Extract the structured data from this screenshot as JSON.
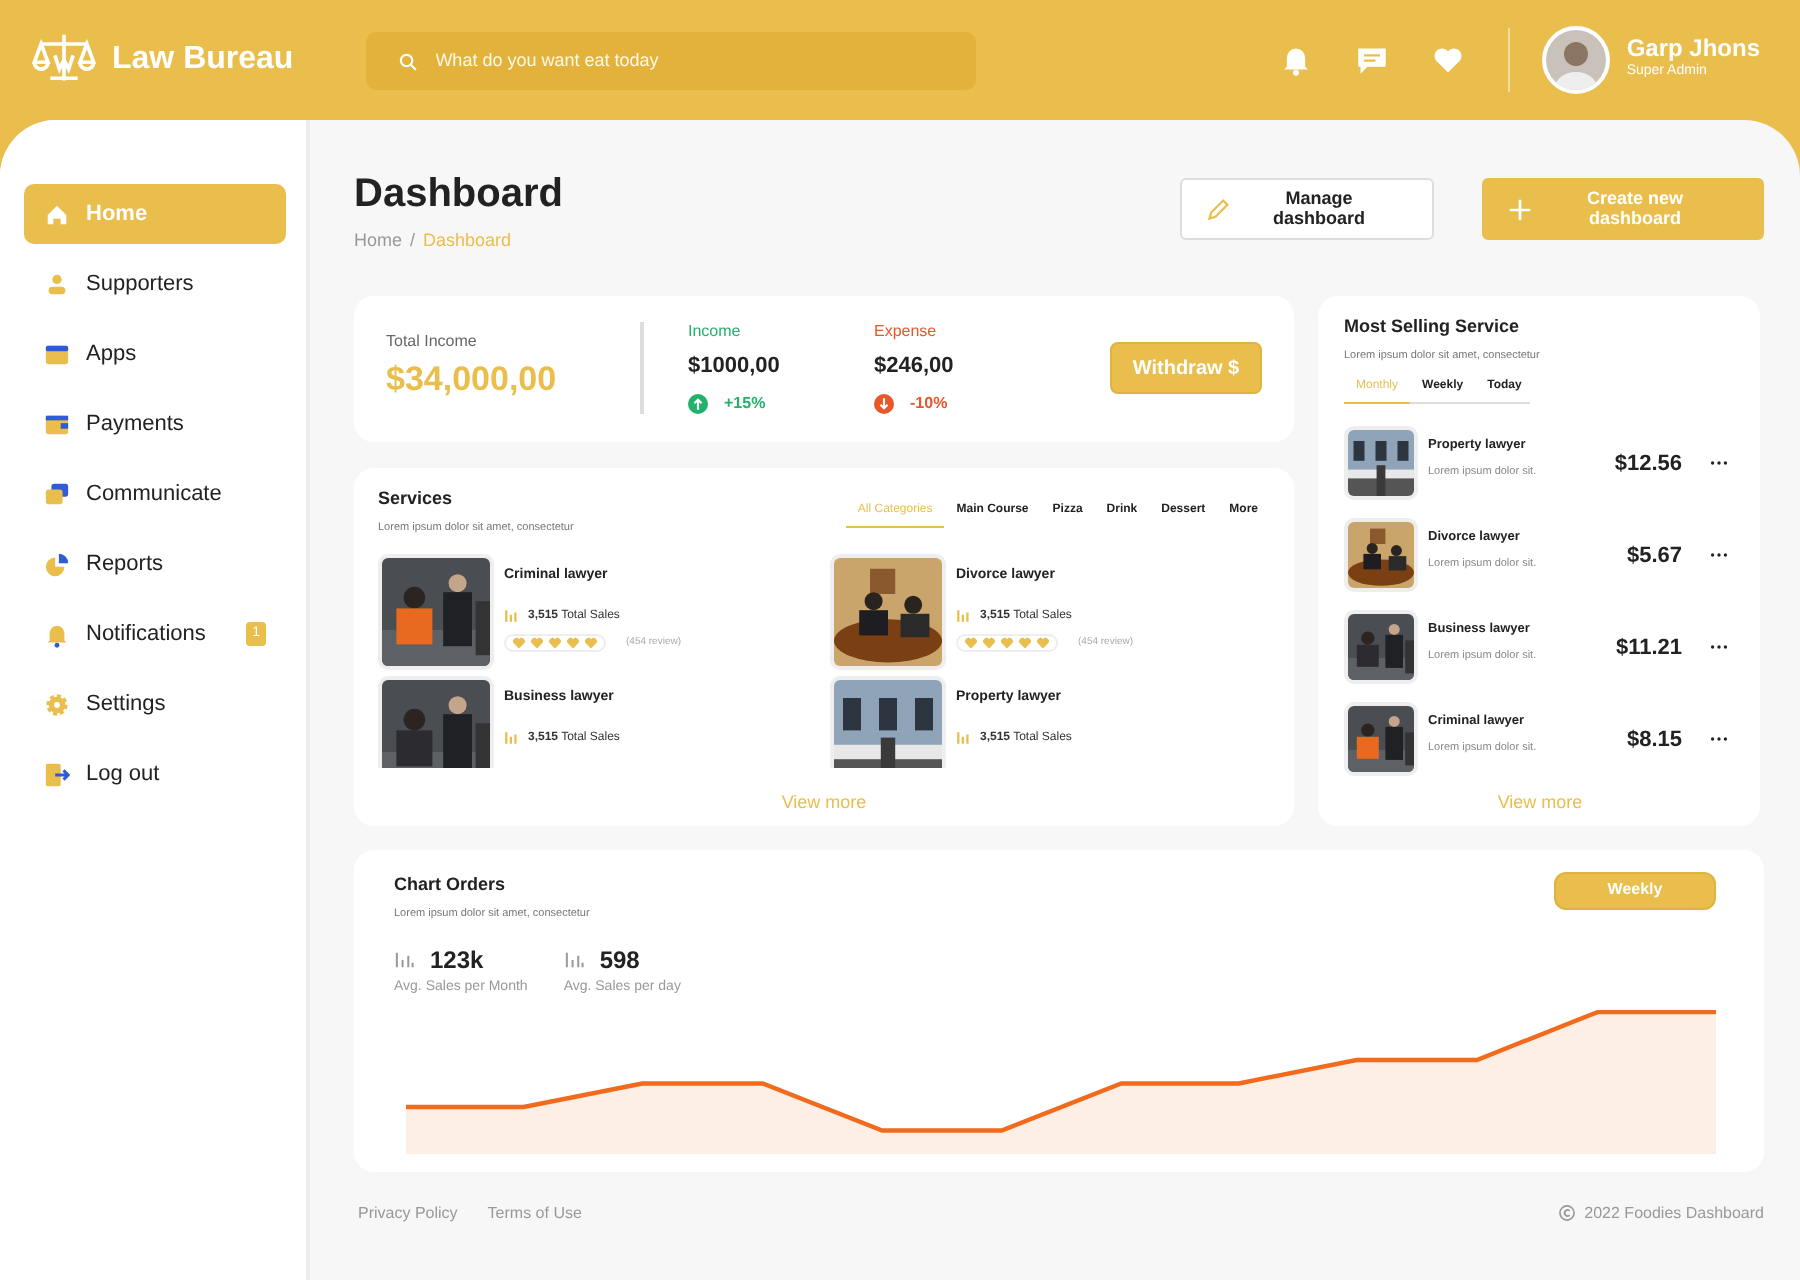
{
  "app": {
    "name": "Law Bureau"
  },
  "search": {
    "placeholder": "What do you want eat today"
  },
  "user": {
    "name": "Garp Jhons",
    "role": "Super Admin"
  },
  "sidebar": {
    "items": [
      {
        "label": "Home",
        "selected": true
      },
      {
        "label": "Supporters",
        "selected": false
      },
      {
        "label": "Apps",
        "selected": false
      },
      {
        "label": "Payments",
        "selected": false
      },
      {
        "label": "Communicate",
        "selected": false
      },
      {
        "label": "Reports",
        "selected": false
      },
      {
        "label": "Notifications",
        "selected": false,
        "badge": "1"
      },
      {
        "label": "Settings",
        "selected": false
      },
      {
        "label": "Log out",
        "selected": false
      }
    ]
  },
  "page": {
    "title": "Dashboard",
    "breadcrumb": [
      {
        "label": "Home",
        "selected": false
      },
      {
        "label": "Dashboard",
        "selected": true
      }
    ],
    "separator": "/"
  },
  "actions": [
    {
      "label": "Manage dashboard",
      "kind": "outline"
    },
    {
      "label": "Create new dashboard",
      "kind": "primary"
    }
  ],
  "income": {
    "label": "Total Income",
    "value": "$34,000,00",
    "stats": [
      {
        "label": "Income",
        "value": "$1000,00",
        "change": "+15%",
        "rising": true
      },
      {
        "label": "Expense",
        "value": "$246,00",
        "change": "-10%",
        "rising": false
      }
    ],
    "button": {
      "label": "Withdraw",
      "symbol": "$"
    }
  },
  "services": {
    "title": "Services",
    "subtitle": "Lorem ipsum dolor sit amet, consectetur",
    "tabs": [
      {
        "label": "All Categories",
        "selected": true
      },
      {
        "label": "Main Course",
        "selected": false
      },
      {
        "label": "Pizza",
        "selected": false
      },
      {
        "label": "Drink",
        "selected": false
      },
      {
        "label": "Dessert",
        "selected": false
      },
      {
        "label": "More",
        "selected": false
      }
    ],
    "items": [
      {
        "name": "Criminal lawyer",
        "sales_count": "3,515",
        "sales_label": "Total Sales",
        "stars": 5,
        "reviews": "(454 review)"
      },
      {
        "name": "Divorce lawyer",
        "sales_count": "3,515",
        "sales_label": "Total Sales",
        "stars": 5,
        "reviews": "(454 review)"
      },
      {
        "name": "Business lawyer",
        "sales_count": "3,515",
        "sales_label": "Total Sales"
      },
      {
        "name": "Property lawyer",
        "sales_count": "3,515",
        "sales_label": "Total Sales"
      }
    ],
    "link": "View more"
  },
  "most_selling": {
    "title": "Most Selling Service",
    "subtitle": "Lorem ipsum dolor sit amet, consectetur",
    "tabs": [
      {
        "label": "Monthly",
        "selected": true
      },
      {
        "label": "Weekly",
        "selected": false
      },
      {
        "label": "Today",
        "selected": false
      }
    ],
    "items": [
      {
        "name": "Property lawyer",
        "description": "Lorem ipsum dolor sit.",
        "price": "$12.56"
      },
      {
        "name": "Divorce lawyer",
        "description": "Lorem ipsum dolor sit.",
        "price": "$5.67"
      },
      {
        "name": "Business lawyer",
        "description": "Lorem ipsum dolor sit.",
        "price": "$11.21"
      },
      {
        "name": "Criminal lawyer",
        "description": "Lorem ipsum dolor sit.",
        "price": "$8.15"
      }
    ],
    "link": "View more"
  },
  "chart_orders": {
    "title": "Chart Orders",
    "subtitle": "Lorem ipsum dolor sit amet, consectetur",
    "button": "Weekly",
    "stats": [
      {
        "value": "123k",
        "label": "Avg. Sales per Month"
      },
      {
        "value": "598",
        "label": "Avg. Sales per day"
      }
    ]
  },
  "footer": {
    "links": [
      "Privacy Policy",
      "Terms of Use"
    ],
    "copyright": "2022 Foodies Dashboard"
  }
}
